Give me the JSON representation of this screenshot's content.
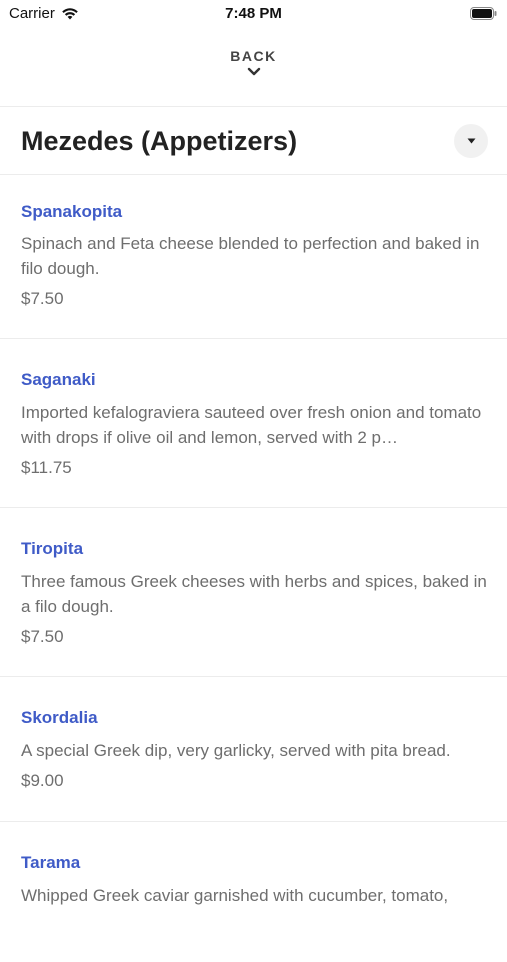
{
  "status_bar": {
    "carrier": "Carrier",
    "time": "7:48 PM"
  },
  "nav": {
    "back_label": "BACK"
  },
  "header": {
    "title": "Mezedes (Appetizers)"
  },
  "menu": {
    "items": [
      {
        "name": "Spanakopita",
        "description": "Spinach and Feta cheese blended to perfection and baked in filo dough.",
        "price": "$7.50"
      },
      {
        "name": "Saganaki",
        "description": "Imported kefalograviera sauteed over fresh onion and tomato with drops if olive oil and lemon, served with 2 p…",
        "price": "$11.75"
      },
      {
        "name": "Tiropita",
        "description": "Three famous Greek cheeses with herbs and spices, baked in a filo dough.",
        "price": "$7.50"
      },
      {
        "name": "Skordalia",
        "description": "A special Greek dip, very garlicky, served with pita bread.",
        "price": "$9.00"
      },
      {
        "name": "Tarama",
        "description": "Whipped Greek caviar garnished with cucumber, tomato,"
      }
    ]
  },
  "colors": {
    "item_name": "#3f5bc7",
    "body_text": "#6e6e6e",
    "divider": "#ececec"
  },
  "icons": {
    "back": "chevron-down-icon",
    "dropdown": "caret-down-icon",
    "wifi": "wifi-icon",
    "battery": "battery-icon"
  }
}
